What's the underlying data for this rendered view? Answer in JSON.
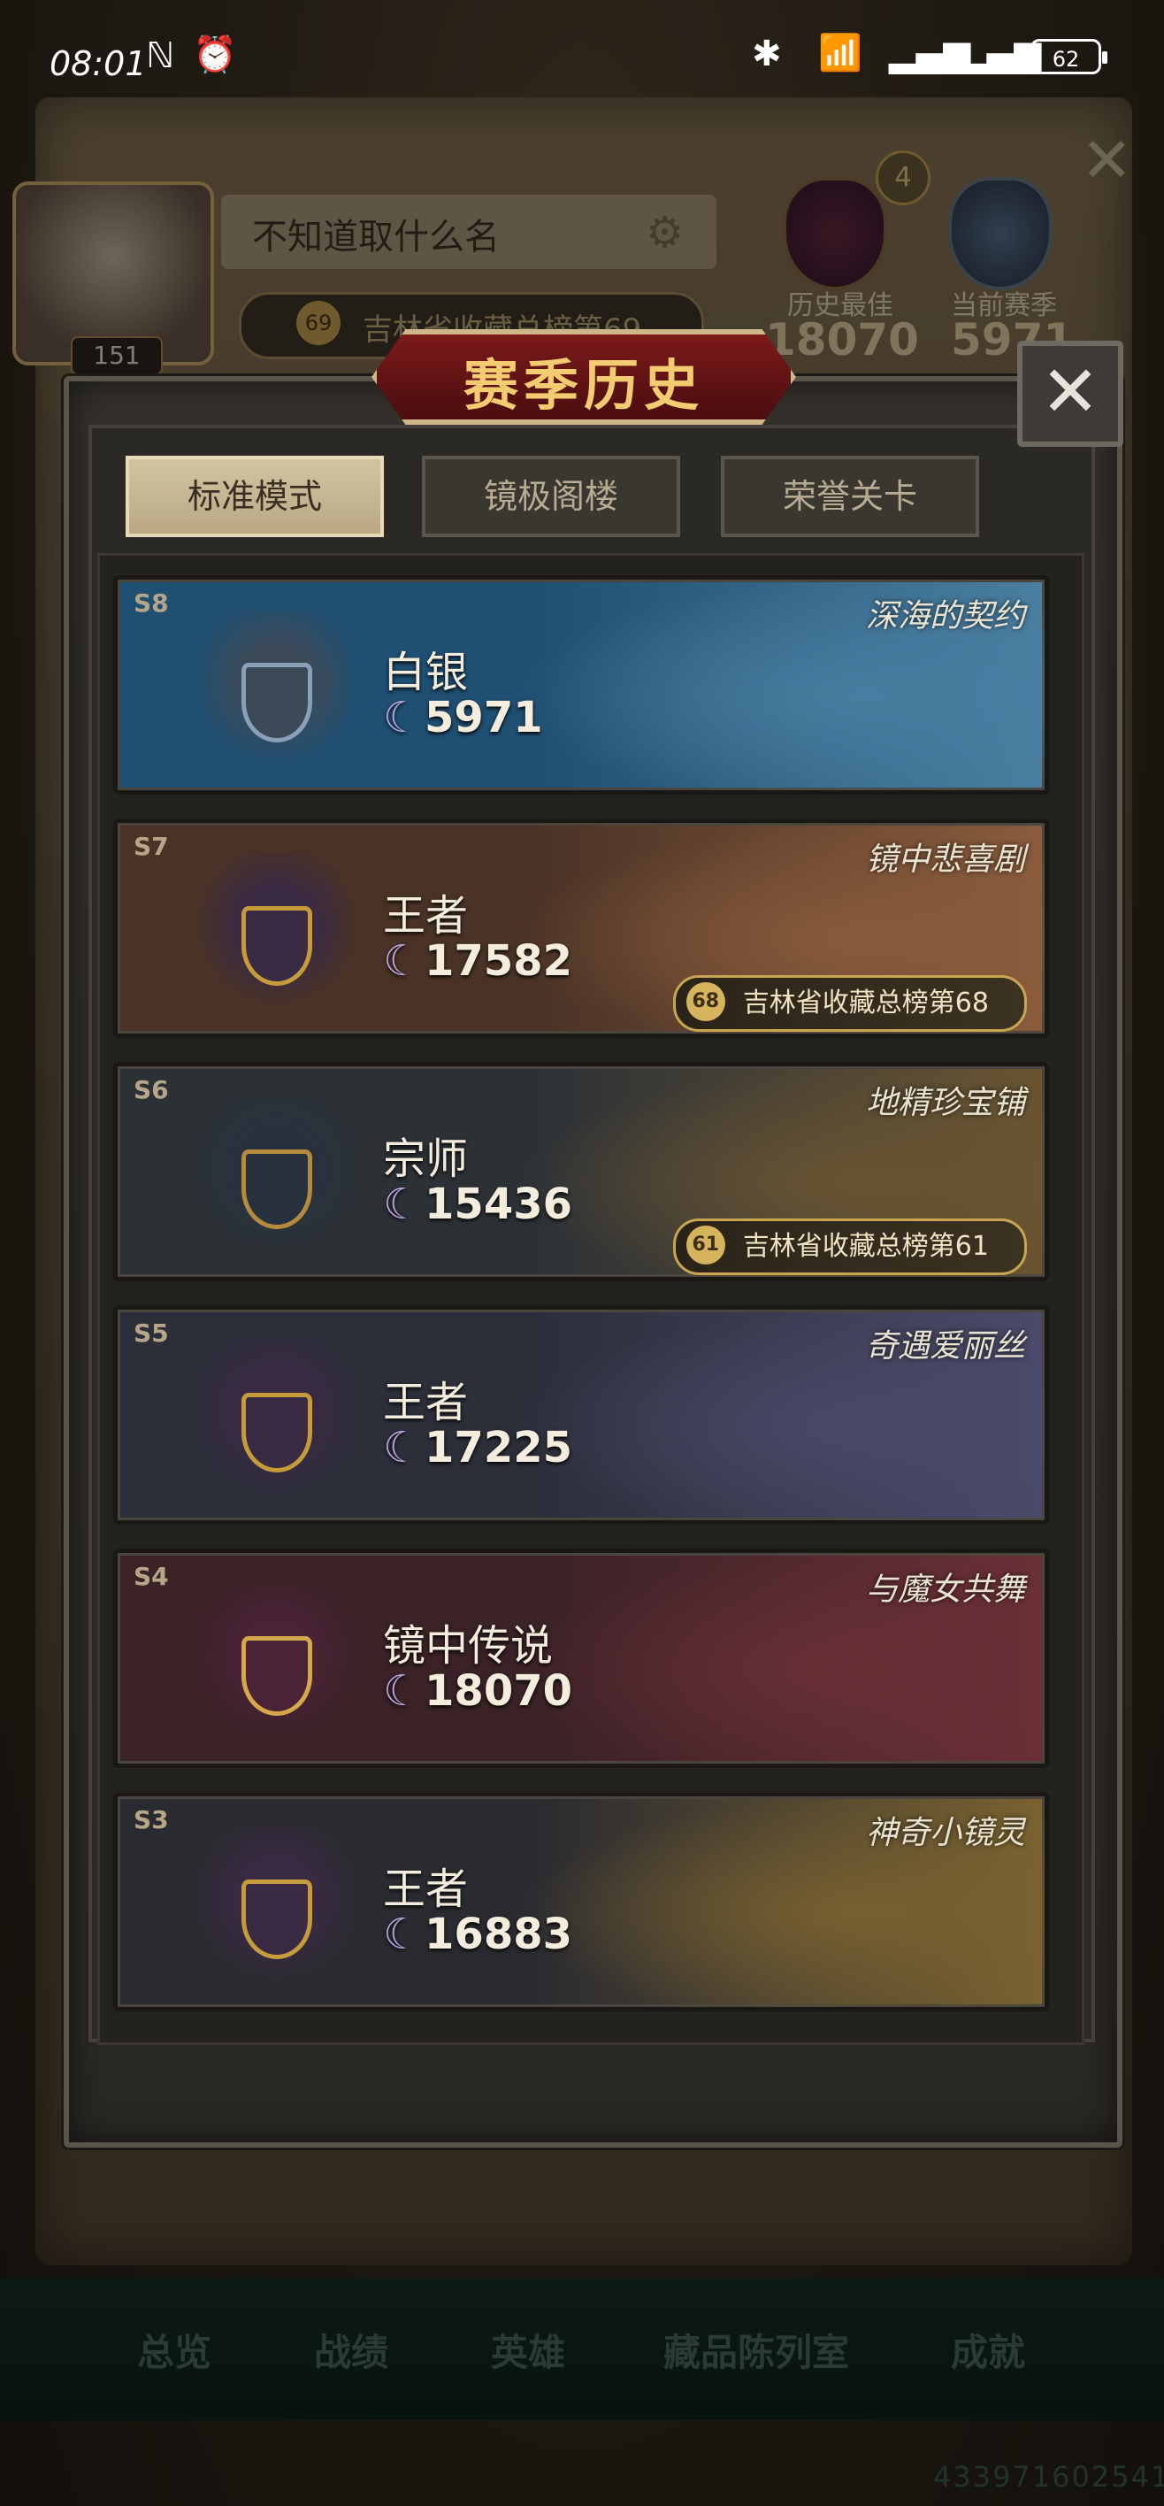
{
  "status_bar": {
    "time": "08:01",
    "battery": "62"
  },
  "profile": {
    "player_name": "不知道取什么名",
    "avatar_level": "151",
    "rank_badge_num": "69",
    "rank_text": "吉林省收藏总榜第69",
    "history_best_label": "历史最佳",
    "history_best_value": "18070",
    "current_season_label": "当前赛季",
    "current_season_value": "5971",
    "star_count": "4"
  },
  "modal": {
    "title": "赛季历史",
    "close_label": "✕",
    "tabs": [
      {
        "label": "标准模式",
        "active": true
      },
      {
        "label": "镜极阁楼",
        "active": false
      },
      {
        "label": "荣誉关卡",
        "active": false
      }
    ]
  },
  "seasons": [
    {
      "season": "S8",
      "theme": "深海的契约",
      "tier": "白银",
      "score": "5971",
      "rank_num": "",
      "rank_text": "",
      "accent": "#1f4f72",
      "art": "#4a7fa2"
    },
    {
      "season": "S7",
      "theme": "镜中悲喜剧",
      "tier": "王者",
      "score": "17582",
      "rank_num": "68",
      "rank_text": "吉林省收藏总榜第68",
      "accent": "#4a3326",
      "art": "#8a5c3c"
    },
    {
      "season": "S6",
      "theme": "地精珍宝铺",
      "tier": "宗师",
      "score": "15436",
      "rank_num": "61",
      "rank_text": "吉林省收藏总榜第61",
      "accent": "#2c3136",
      "art": "#6a5532"
    },
    {
      "season": "S5",
      "theme": "奇遇爱丽丝",
      "tier": "王者",
      "score": "17225",
      "rank_num": "",
      "rank_text": "",
      "accent": "#2c2e3a",
      "art": "#4b4a6a"
    },
    {
      "season": "S4",
      "theme": "与魔女共舞",
      "tier": "镜中传说",
      "score": "18070",
      "rank_num": "",
      "rank_text": "",
      "accent": "#3a2227",
      "art": "#6a3036"
    },
    {
      "season": "S3",
      "theme": "神奇小镜灵",
      "tier": "王者",
      "score": "16883",
      "rank_num": "",
      "rank_text": "",
      "accent": "#2a2b30",
      "art": "#7a6230"
    }
  ],
  "bottom_nav": [
    "总览",
    "战绩",
    "英雄",
    "藏品陈列室",
    "成就"
  ],
  "uid": "433971602541"
}
